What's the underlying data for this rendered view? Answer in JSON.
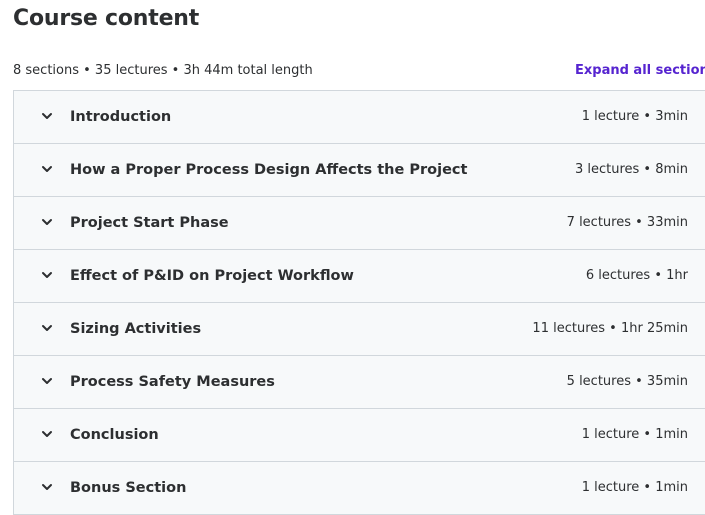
{
  "header": {
    "title": "Course content",
    "summary": "8 sections • 35 lectures • 3h 44m total length",
    "expand_all_label": "Expand all sections"
  },
  "sections": [
    {
      "title": "Introduction",
      "meta": "1 lecture • 3min"
    },
    {
      "title": "How a Proper Process Design Affects the Project",
      "meta": "3 lectures • 8min"
    },
    {
      "title": "Project Start Phase",
      "meta": "7 lectures • 33min"
    },
    {
      "title": "Effect of P&ID on Project Workflow",
      "meta": "6 lectures • 1hr"
    },
    {
      "title": "Sizing Activities",
      "meta": "11 lectures • 1hr 25min"
    },
    {
      "title": "Process Safety Measures",
      "meta": "5 lectures • 35min"
    },
    {
      "title": "Conclusion",
      "meta": "1 lecture • 1min"
    },
    {
      "title": "Bonus Section",
      "meta": "1 lecture • 1min"
    }
  ],
  "icons": {
    "section_toggle": "chevron-down-icon"
  },
  "colors": {
    "accent": "#5624d0",
    "text": "#2d2f31",
    "section_bg": "#f7f9fa",
    "border": "#d1d7dc"
  }
}
